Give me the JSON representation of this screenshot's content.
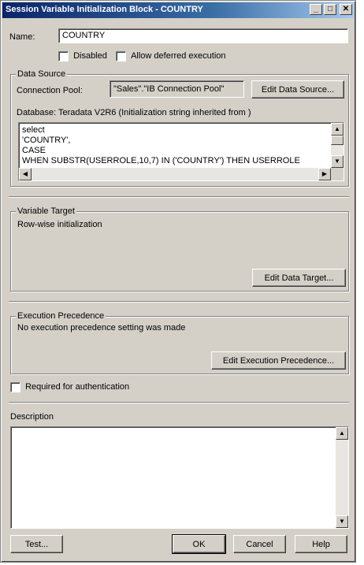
{
  "window": {
    "title": "Session Variable Initialization Block - COUNTRY"
  },
  "titlebar_buttons": {
    "minimize": "_",
    "maximize": "□",
    "close": "✕"
  },
  "name": {
    "label": "Name:",
    "value": "COUNTRY"
  },
  "options": {
    "disabled_label": "Disabled",
    "deferred_label": "Allow deferred execution"
  },
  "data_source": {
    "legend": "Data Source",
    "connection_pool_label": "Connection Pool:",
    "connection_pool_value": "\"Sales\".\"IB Connection Pool\"",
    "edit_button": "Edit Data Source...",
    "database_text": "Database: Teradata V2R6 (Initialization string inherited from )",
    "sql_lines": [
      "select",
      "'COUNTRY',",
      "CASE",
      "WHEN  SUBSTR(USERROLE,10,7) IN ('COUNTRY') THEN USERROLE"
    ]
  },
  "variable_target": {
    "legend": "Variable Target",
    "text": "Row-wise initialization",
    "edit_button": "Edit Data Target..."
  },
  "execution_precedence": {
    "legend": "Execution Precedence",
    "text": "No execution precedence setting was made",
    "edit_button": "Edit Execution Precedence..."
  },
  "required_auth_label": "Required for authentication",
  "description": {
    "label": "Description",
    "value": ""
  },
  "footer": {
    "test": "Test...",
    "ok": "OK",
    "cancel": "Cancel",
    "help": "Help"
  }
}
